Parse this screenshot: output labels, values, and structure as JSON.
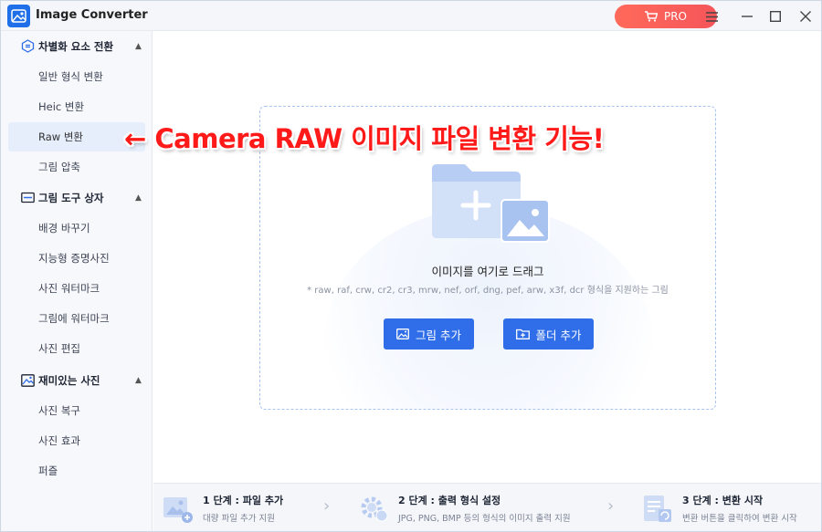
{
  "window": {
    "title": "Image Converter",
    "pro_label": "PRO",
    "accent": "#2f6ee8",
    "pro_color": "#f5555a"
  },
  "sidebar": {
    "groups": [
      {
        "label": "차별화 요소 전환",
        "icon": "convert-icon",
        "items": [
          {
            "label": "일반 형식 변환"
          },
          {
            "label": "Heic 변환"
          },
          {
            "label": "Raw 변환",
            "active": true
          },
          {
            "label": "그림 압축"
          }
        ]
      },
      {
        "label": "그림 도구 상자",
        "icon": "toolbox-icon",
        "items": [
          {
            "label": "배경 바꾸기"
          },
          {
            "label": "지능형 증명사진"
          },
          {
            "label": "사진 워터마크"
          },
          {
            "label": "그림에 워터마크"
          },
          {
            "label": "사진 편집"
          }
        ]
      },
      {
        "label": "재미있는 사진",
        "icon": "photo-icon",
        "items": [
          {
            "label": "사진 복구"
          },
          {
            "label": "사진 효과"
          },
          {
            "label": "퍼즐"
          }
        ]
      }
    ]
  },
  "dropzone": {
    "title": "이미지를 여기로 드래그",
    "formats": "* raw, raf, crw, cr2, cr3, mrw, nef, orf, dng, pef, arw, x3f, dcr 형식을 지원하는 그림",
    "add_image_label": "그림 추가",
    "add_folder_label": "폴더 추가"
  },
  "annotation": {
    "text": "← Camera RAW 이미지 파일 변환 기능!",
    "color": "#ff1a1a"
  },
  "steps": [
    {
      "title": "1 단계 : 파일 추가",
      "desc": "대량 파일 추가 지원"
    },
    {
      "title": "2 단계 : 출력 형식 설정",
      "desc": "JPG, PNG, BMP 등의 형식의 이미지 출력 지원"
    },
    {
      "title": "3 단계 : 변환 시작",
      "desc": "변환 버튼을 클릭하여 변환 시작"
    }
  ]
}
